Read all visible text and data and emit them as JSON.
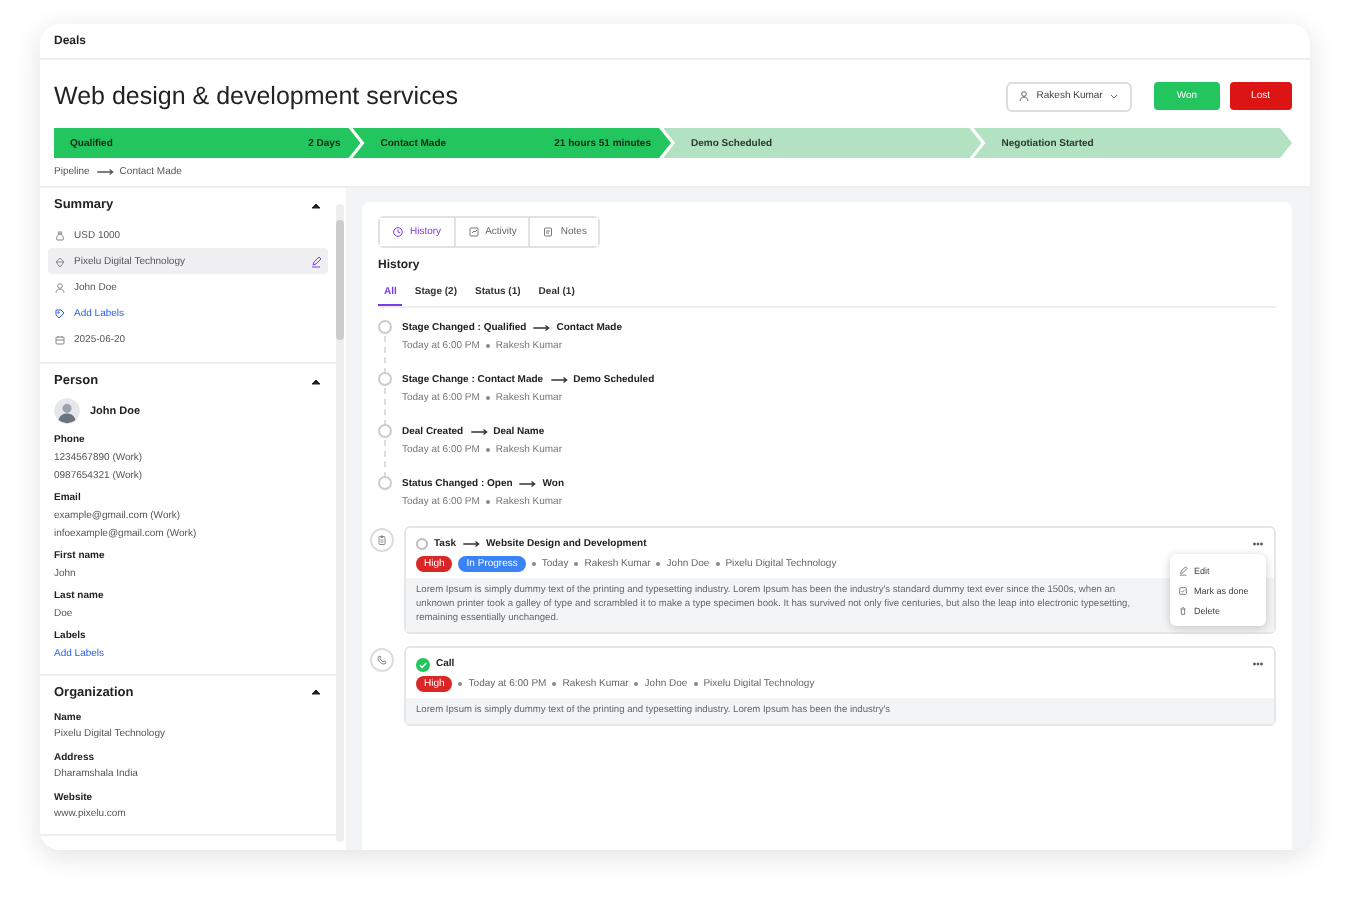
{
  "header": {
    "title": "Deals"
  },
  "deal": {
    "title": "Web design & development services",
    "owner": "Rakesh Kumar",
    "buttons": [
      {
        "label": "Won",
        "kind": "won"
      },
      {
        "label": "Lost",
        "kind": "lost"
      }
    ]
  },
  "pipeline": [
    {
      "label": "Qualified",
      "duration": "2 Days",
      "reached": true
    },
    {
      "label": "Contact Made",
      "duration": "21 hours 51 minutes",
      "reached": true
    },
    {
      "label": "Demo Scheduled",
      "reached": false
    },
    {
      "label": "Negotiation Started",
      "reached": false
    }
  ],
  "breadcrumb": [
    "Pipeline",
    "Contact Made"
  ],
  "summary": {
    "title": "Summary",
    "expanded": true,
    "items": [
      {
        "kind": "amount",
        "text": "USD 1000",
        "selected": false
      },
      {
        "kind": "organization",
        "text": "Pixelu Digital Technology",
        "selected": true
      },
      {
        "kind": "person",
        "text": "John Doe",
        "selected": false
      },
      {
        "kind": "labels",
        "text": "Add Labels",
        "selected": false
      },
      {
        "kind": "date",
        "text": "2025-06-20",
        "selected": false
      }
    ]
  },
  "person": {
    "title": "Person",
    "expanded": true,
    "name": "John Doe",
    "fields": [
      {
        "label": "Phone",
        "values": [
          "1234567890 (Work)",
          "0987654321 (Work)"
        ]
      },
      {
        "label": "Email",
        "values": [
          "example@gmail.com (Work)",
          "infoexample@gmail.com (Work)"
        ]
      },
      {
        "label": "First name",
        "values": [
          "John"
        ]
      },
      {
        "label": "Last name",
        "values": [
          "Doe"
        ]
      },
      {
        "label": "Labels",
        "values": [
          "Add Labels"
        ],
        "kind": "link"
      }
    ]
  },
  "organization": {
    "title": "Organization",
    "expanded": true,
    "fields": [
      {
        "label": "Name",
        "values": [
          "Pixelu Digital Technology"
        ]
      },
      {
        "label": "Address",
        "values": [
          "Dharamshala India"
        ]
      },
      {
        "label": "Website",
        "values": [
          "www.pixelu.com"
        ]
      }
    ]
  },
  "tabs": [
    {
      "label": "History",
      "kind": "history",
      "selected": true
    },
    {
      "label": "Activity",
      "kind": "activity",
      "selected": false
    },
    {
      "label": "Notes",
      "kind": "notes",
      "selected": false
    }
  ],
  "history": {
    "title": "History",
    "filters": [
      {
        "label": "All",
        "selected": true
      },
      {
        "label": "Stage (2)",
        "selected": false
      },
      {
        "label": "Status (1)",
        "selected": false
      },
      {
        "label": "Deal (1)",
        "selected": false
      }
    ],
    "events": [
      {
        "from": "Stage Changed : Qualified",
        "to": "Contact Made",
        "meta": [
          "Today at 6:00 PM",
          "Rakesh Kumar"
        ]
      },
      {
        "from": "Stage Change : Contact Made",
        "to": "Demo Scheduled",
        "meta": [
          "Today at 6:00 PM",
          "Rakesh Kumar"
        ]
      },
      {
        "from": "Deal Created",
        "to": "Deal Name",
        "meta": [
          "Today at 6:00 PM",
          "Rakesh Kumar"
        ]
      },
      {
        "from": "Status Changed : Open",
        "to": "Won",
        "meta": [
          "Today at 6:00 PM",
          "Rakesh Kumar"
        ]
      }
    ]
  },
  "activities": [
    {
      "kind": "task",
      "done": false,
      "type": "Task",
      "subject": "Website Design and Development",
      "tags": [
        {
          "label": "High",
          "color": "#dc2626"
        },
        {
          "label": "In Progress",
          "color": "#3b82f6"
        }
      ],
      "meta": [
        "Today",
        "Rakesh Kumar",
        "John Doe",
        "Pixelu Digital Technology"
      ],
      "description": "Lorem Ipsum is simply dummy text of the printing and typesetting industry. Lorem Ipsum has been the industry's standard dummy text ever since the 1500s, when an unknown printer took a galley of type and scrambled it to make a type specimen book. It has survived not only five centuries, but also the leap into electronic typesetting, remaining essentially unchanged.",
      "menu": [
        {
          "kind": "edit",
          "label": "Edit"
        },
        {
          "kind": "done",
          "label": "Mark as done"
        },
        {
          "kind": "delete",
          "label": "Delete"
        }
      ]
    },
    {
      "kind": "call",
      "done": true,
      "type": "Call",
      "tags": [
        {
          "label": "High",
          "color": "#dc2626"
        }
      ],
      "meta": [
        "Today at 6:00 PM",
        "Rakesh Kumar",
        "John Doe",
        "Pixelu Digital Technology"
      ],
      "description": "Lorem Ipsum is simply dummy text of the printing and typesetting industry. Lorem Ipsum has been the industry's"
    }
  ]
}
